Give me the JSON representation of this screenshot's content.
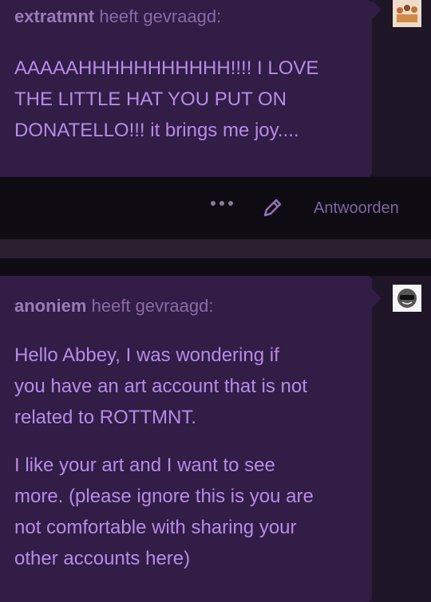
{
  "post1": {
    "asker_name": "extratmnt",
    "asker_suffix": "heeft gevraagd:",
    "question_lines": [
      "AAAAAHHHHHHHHHHH!!!! I LOVE",
      "THE LITTLE HAT YOU PUT ON",
      "DONATELLO!!! it brings me joy...."
    ]
  },
  "actions": {
    "more_label": "•••",
    "answer_label": "Antwoorden"
  },
  "post2": {
    "asker_name": "anoniem",
    "asker_suffix": "heeft gevraagd:",
    "paragraph1_lines": [
      "Hello Abbey, I was wondering if",
      "you have an art account that is not",
      "related to ROTTMNT."
    ],
    "paragraph2_lines": [
      "I like your art and I want to see",
      "more. (please ignore this is you are",
      "not comfortable with sharing your",
      "other accounts here)"
    ]
  },
  "colors": {
    "bubble": "#311d45",
    "question_text": "#b78be8",
    "asker_text": "#8b6aa6",
    "action_text": "#7d67a0",
    "background": "#1e1526"
  },
  "icons": [
    "more-dots-icon",
    "edit-pencil-icon",
    "avatar-icon",
    "anonymous-avatar-icon"
  ]
}
